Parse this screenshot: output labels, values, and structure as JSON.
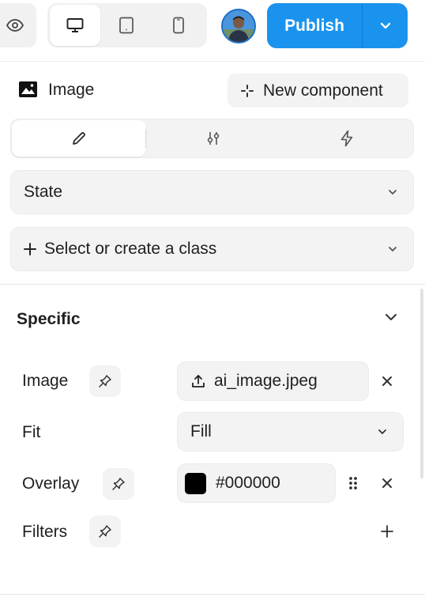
{
  "toolbar": {
    "preview_icon": "eye-icon",
    "devices": [
      {
        "name": "desktop",
        "icon": "monitor-icon",
        "active": true
      },
      {
        "name": "tablet",
        "icon": "tablet-icon",
        "active": false
      },
      {
        "name": "mobile",
        "icon": "phone-icon",
        "active": false
      }
    ],
    "avatar_icon": "user-avatar",
    "publish_label": "Publish",
    "publish_color": "#1a93ee"
  },
  "element": {
    "icon": "image-icon",
    "title": "Image",
    "new_component_label": "New component"
  },
  "tabs": [
    {
      "icon": "pencil-icon",
      "active": true
    },
    {
      "icon": "sliders-icon",
      "active": false
    },
    {
      "icon": "lightning-icon",
      "active": false
    }
  ],
  "state": {
    "label": "State"
  },
  "class_selector": {
    "label": "Select or create a class"
  },
  "specific": {
    "title": "Specific",
    "image": {
      "label": "Image",
      "value": "ai_image.jpeg"
    },
    "fit": {
      "label": "Fit",
      "value": "Fill"
    },
    "overlay": {
      "label": "Overlay",
      "value": "#000000",
      "swatch": "#000000"
    },
    "filters": {
      "label": "Filters"
    }
  }
}
